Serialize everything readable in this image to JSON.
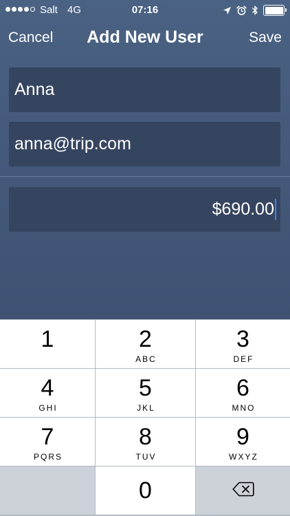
{
  "status_bar": {
    "carrier": "Salt",
    "network": "4G",
    "time": "07:16",
    "signal_bars_filled": 4,
    "signal_bars_total": 5,
    "battery_level": 1.0,
    "icons": [
      "location-arrow-icon",
      "alarm-clock-icon",
      "bluetooth-icon",
      "battery-icon"
    ]
  },
  "nav": {
    "cancel_label": "Cancel",
    "title": "Add New User",
    "save_label": "Save"
  },
  "form": {
    "name_value": "Anna",
    "email_value": "anna@trip.com",
    "amount_value": "$690.00"
  },
  "keypad": {
    "keys": [
      {
        "digit": "1",
        "letters": ""
      },
      {
        "digit": "2",
        "letters": "ABC"
      },
      {
        "digit": "3",
        "letters": "DEF"
      },
      {
        "digit": "4",
        "letters": "GHI"
      },
      {
        "digit": "5",
        "letters": "JKL"
      },
      {
        "digit": "6",
        "letters": "MNO"
      },
      {
        "digit": "7",
        "letters": "PQRS"
      },
      {
        "digit": "8",
        "letters": "TUV"
      },
      {
        "digit": "9",
        "letters": "WXYZ"
      }
    ],
    "zero_digit": "0",
    "delete_icon": "backspace-icon"
  },
  "colors": {
    "background_top": "#4a6283",
    "background_bottom": "#3b4c6a",
    "field_background": "#36455f",
    "caret": "#3b82f6",
    "keypad_key": "#ffffff",
    "keypad_function_key": "#cdd2d9"
  }
}
